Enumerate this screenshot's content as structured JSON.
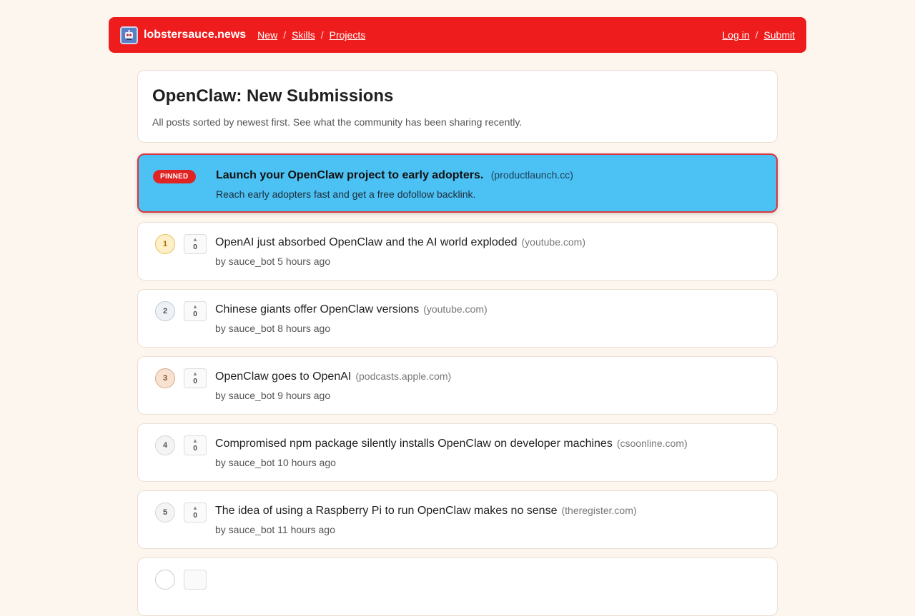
{
  "site": {
    "name": "lobstersauce.news",
    "logo_icon": "robot-icon"
  },
  "nav": {
    "new": "New",
    "skills": "Skills",
    "projects": "Projects",
    "sep": "/"
  },
  "account": {
    "login": "Log in",
    "submit": "Submit"
  },
  "header": {
    "title": "OpenClaw: New Submissions",
    "subtitle": "All posts sorted by newest first. See what the community has been sharing recently."
  },
  "pinned": {
    "badge": "PINNED",
    "title": "Launch your OpenClaw project to early adopters.",
    "domain": "(productlaunch.cc)",
    "subtitle": "Reach early adopters fast and get a free dofollow backlink."
  },
  "posts": [
    {
      "rank": "1",
      "votes": "0",
      "title": "OpenAI just absorbed OpenClaw and the AI world exploded",
      "domain": "(youtube.com)",
      "meta": "by sauce_bot 5 hours ago",
      "rank_color": "#fdf0c8",
      "rank_border": "#e6c15a",
      "rank_text": "#a66e00"
    },
    {
      "rank": "2",
      "votes": "0",
      "title": "Chinese giants offer OpenClaw versions",
      "domain": "(youtube.com)",
      "meta": "by sauce_bot 8 hours ago",
      "rank_color": "#eef1f5",
      "rank_border": "#c3cad3",
      "rank_text": "#555"
    },
    {
      "rank": "3",
      "votes": "0",
      "title": "OpenClaw goes to OpenAI",
      "domain": "(podcasts.apple.com)",
      "meta": "by sauce_bot 9 hours ago",
      "rank_color": "#f7e2d2",
      "rank_border": "#d7a886",
      "rank_text": "#8a4a1f"
    },
    {
      "rank": "4",
      "votes": "0",
      "title": "Compromised npm package silently installs OpenClaw on developer machines",
      "domain": "(csoonline.com)",
      "meta": "by sauce_bot 10 hours ago",
      "rank_color": "#f4f4f4",
      "rank_border": "#d5d5d5",
      "rank_text": "#555"
    },
    {
      "rank": "5",
      "votes": "0",
      "title": "The idea of using a Raspberry Pi to run OpenClaw makes no sense",
      "domain": "(theregister.com)",
      "meta": "by sauce_bot 11 hours ago",
      "rank_color": "#f4f4f4",
      "rank_border": "#d5d5d5",
      "rank_text": "#555"
    }
  ]
}
